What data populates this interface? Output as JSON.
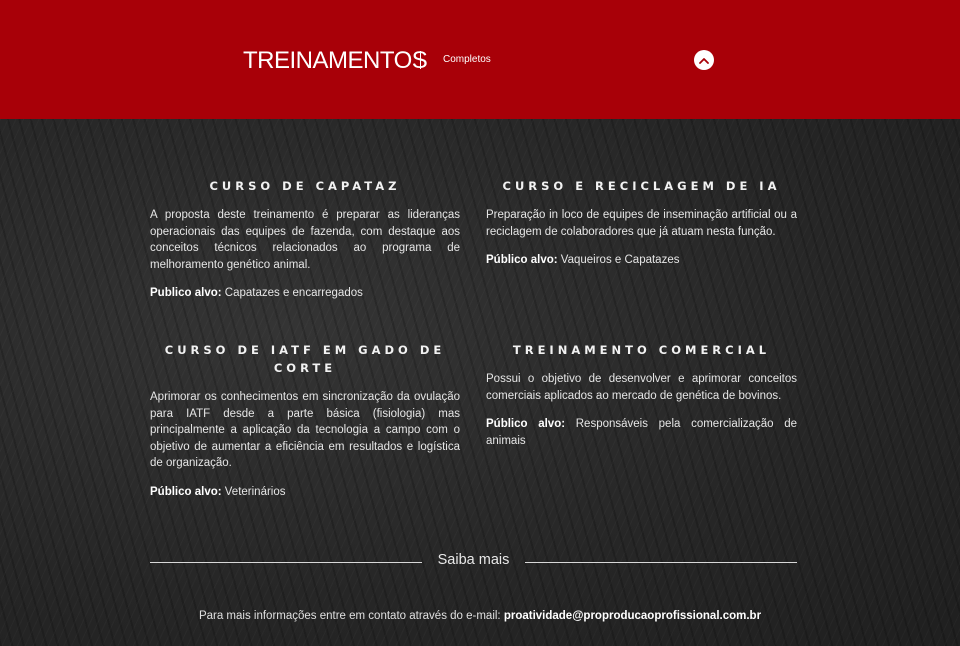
{
  "header": {
    "title": "TREINAMENTOS",
    "subtitle": "Completos",
    "background": "#a80008",
    "toggle_icon": "chevron-up-icon"
  },
  "courses": [
    {
      "title": "CURSO DE CAPATAZ",
      "description": "A proposta deste treinamento é preparar as lideranças operacionais das equipes de fazenda, com destaque aos conceitos técnicos relacionados ao programa de melhoramento genético animal.",
      "audience_label": "Publico alvo:",
      "audience": " Capatazes e encarregados"
    },
    {
      "title": "CURSO E RECICLAGEM DE IA",
      "description": "Preparação in loco de equipes de inseminação artificial ou a reciclagem de colaboradores que já atuam nesta função.",
      "audience_label": "Público alvo:",
      "audience": " Vaqueiros e Capatazes"
    },
    {
      "title": "CURSO DE IATF EM GADO DE CORTE",
      "description": "Aprimorar os conhecimentos em sincronização da ovulação para IATF desde a parte básica (fisiologia) mas principalmente a aplicação da tecnologia a campo com o objetivo de aumentar a eficiência em resultados e logística de organização.",
      "audience_label": "Público alvo:",
      "audience": " Veterinários"
    },
    {
      "title": "TREINAMENTO COMERCIAL",
      "description": "Possui o objetivo de desenvolver e aprimorar conceitos comerciais aplicados ao mercado de genética de bovinos.",
      "audience_label": "Público alvo:",
      "audience": " Responsáveis pela comercialização de animais"
    }
  ],
  "more": {
    "label": "Saiba mais"
  },
  "contact": {
    "text": "Para mais informações entre em contato através do e-mail: ",
    "email": "proatividade@proproducaoprofissional.com.br"
  }
}
